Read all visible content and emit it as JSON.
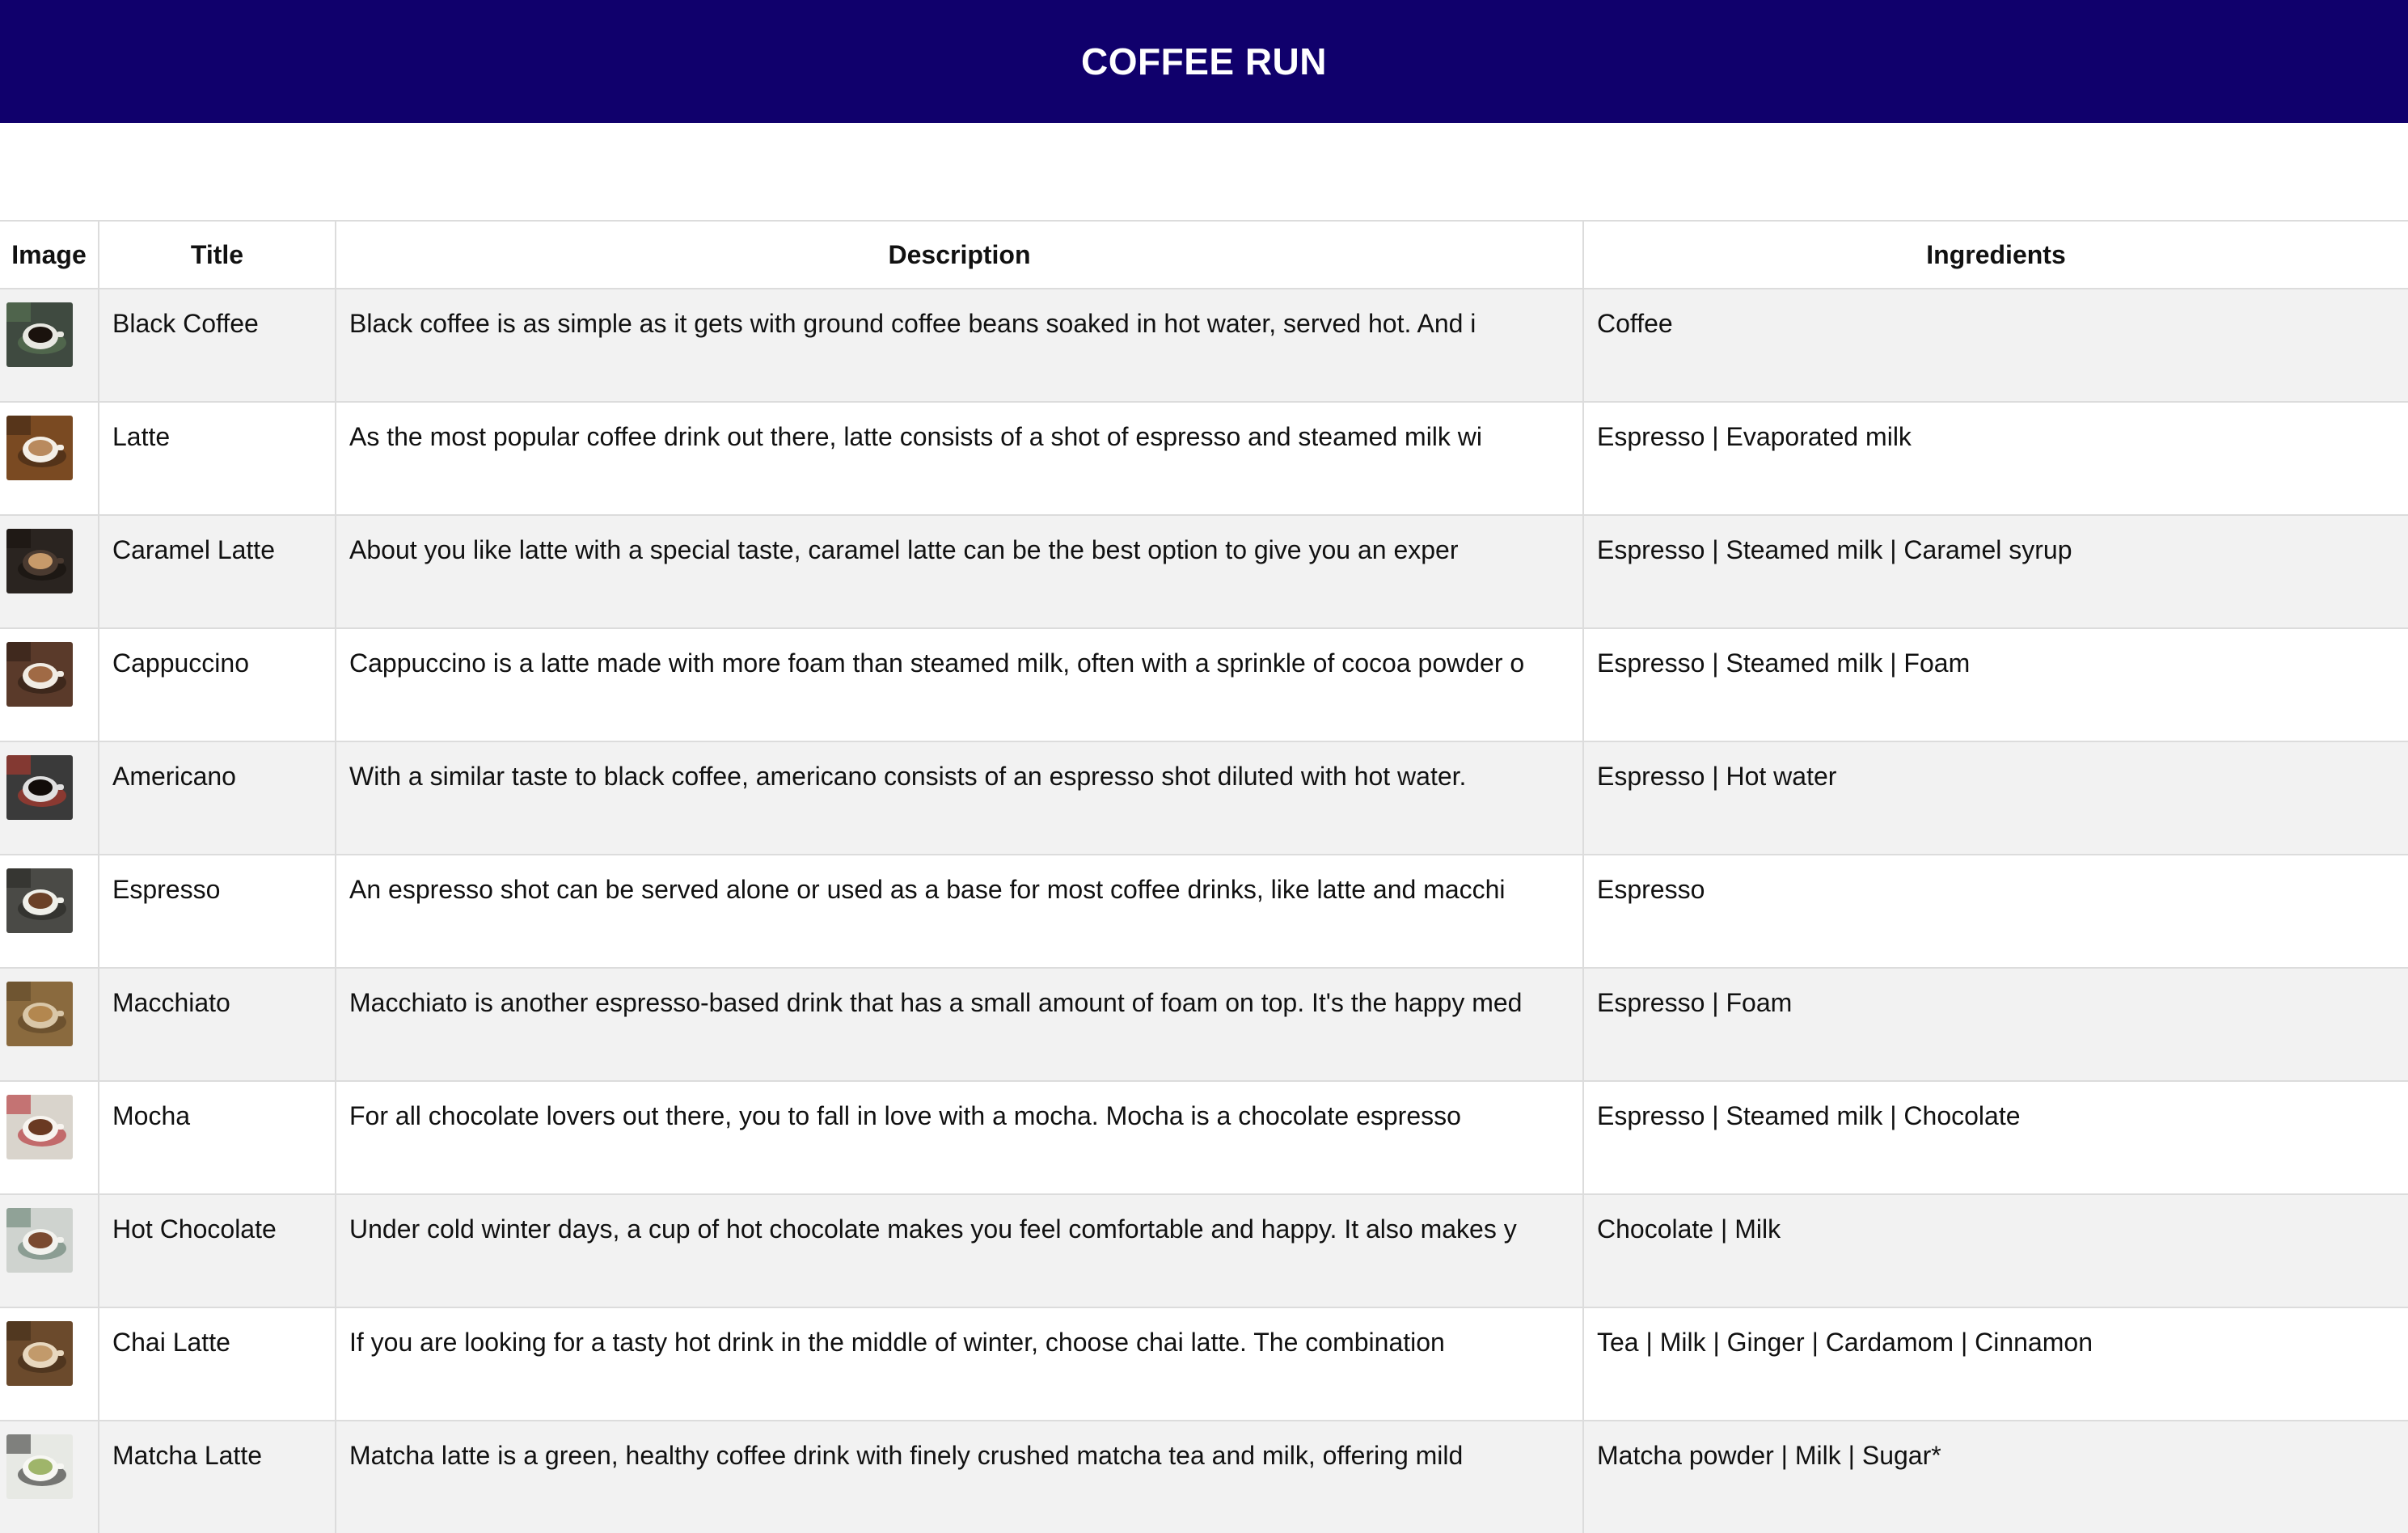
{
  "header": {
    "title": "COFFEE RUN"
  },
  "table": {
    "columns": [
      "Image",
      "Title",
      "Description",
      "Ingredients"
    ],
    "rows": [
      {
        "title": "Black Coffee",
        "description": "Black coffee is as simple as it gets with ground coffee beans soaked in hot water, served hot. And i",
        "ingredients": "Coffee",
        "image": "black-coffee-photo",
        "thumb": {
          "bg": "#3f4a40",
          "cup": "#e8e8e2",
          "drink": "#1a120d",
          "accent": "#5c7a55"
        }
      },
      {
        "title": "Latte",
        "description": "As the most popular coffee drink out there, latte consists of a shot of espresso and steamed milk wi",
        "ingredients": "Espresso | Evaporated milk",
        "image": "latte-photo",
        "thumb": {
          "bg": "#7a4a22",
          "cup": "#f4efe7",
          "drink": "#b98a5e",
          "accent": "#3b2414"
        }
      },
      {
        "title": "Caramel Latte",
        "description": "About you like latte with a special taste, caramel latte can be the best option to give you an exper",
        "ingredients": "Espresso | Steamed milk | Caramel syrup",
        "image": "caramel-latte-photo",
        "thumb": {
          "bg": "#2a2420",
          "cup": "#4a3a30",
          "drink": "#c79a6a",
          "accent": "#15100d"
        }
      },
      {
        "title": "Cappuccino",
        "description": "Cappuccino is a latte made with more foam than steamed milk, often with a sprinkle of cocoa powder o",
        "ingredients": "Espresso | Steamed milk | Foam",
        "image": "cappuccino-photo",
        "thumb": {
          "bg": "#5a3a2a",
          "cup": "#f1ece4",
          "drink": "#a06a45",
          "accent": "#2b1c14"
        }
      },
      {
        "title": "Americano",
        "description": "With a similar taste to black coffee, americano consists of an espresso shot diluted with hot water.",
        "ingredients": "Espresso | Hot water",
        "image": "americano-photo",
        "thumb": {
          "bg": "#3a3a3a",
          "cup": "#e0e0e0",
          "drink": "#110c09",
          "accent": "#c0392b"
        }
      },
      {
        "title": "Espresso",
        "description": "An espresso shot can be served alone or used as a base for most coffee drinks, like latte and macchi",
        "ingredients": "Espresso",
        "image": "espresso-photo",
        "thumb": {
          "bg": "#4a4a46",
          "cup": "#efefe9",
          "drink": "#6b4128",
          "accent": "#262622"
        }
      },
      {
        "title": "Macchiato",
        "description": "Macchiato is another espresso-based drink that has a small amount of foam on top. It's the happy med",
        "ingredients": "Espresso | Foam",
        "image": "macchiato-photo",
        "thumb": {
          "bg": "#8a6a3e",
          "cup": "#d9c7a8",
          "drink": "#b3874f",
          "accent": "#5a4326"
        }
      },
      {
        "title": "Mocha",
        "description": "For all chocolate lovers out there, you to fall in love with a mocha. Mocha is a chocolate espresso",
        "ingredients": "Espresso | Steamed milk | Chocolate",
        "image": "mocha-photo",
        "thumb": {
          "bg": "#d9d4cc",
          "cup": "#f7f4ef",
          "drink": "#6a3a22",
          "accent": "#b2232a"
        }
      },
      {
        "title": "Hot Chocolate",
        "description": "Under cold winter days, a cup of hot chocolate makes you feel comfortable and happy. It also makes y",
        "ingredients": "Chocolate | Milk",
        "image": "hot-chocolate-photo",
        "thumb": {
          "bg": "#cfd3cf",
          "cup": "#f2f2ee",
          "drink": "#7a4a30",
          "accent": "#5d7a6a"
        }
      },
      {
        "title": "Chai Latte",
        "description": "If you are looking for a tasty hot drink in the middle of winter, choose chai latte. The combination",
        "ingredients": "Tea | Milk | Ginger | Cardamom | Cinnamon",
        "image": "chai-latte-photo",
        "thumb": {
          "bg": "#6b4a2c",
          "cup": "#e8d8bf",
          "drink": "#c29a6b",
          "accent": "#3d2a18"
        }
      },
      {
        "title": "Matcha Latte",
        "description": "Matcha latte is a green, healthy coffee drink with finely crushed matcha tea and milk, offering mild",
        "ingredients": "Matcha powder | Milk | Sugar*",
        "image": "matcha-latte-photo",
        "thumb": {
          "bg": "#e7e9e4",
          "cup": "#f7f7f3",
          "drink": "#9fb56a",
          "accent": "#2a2a28"
        }
      }
    ]
  }
}
